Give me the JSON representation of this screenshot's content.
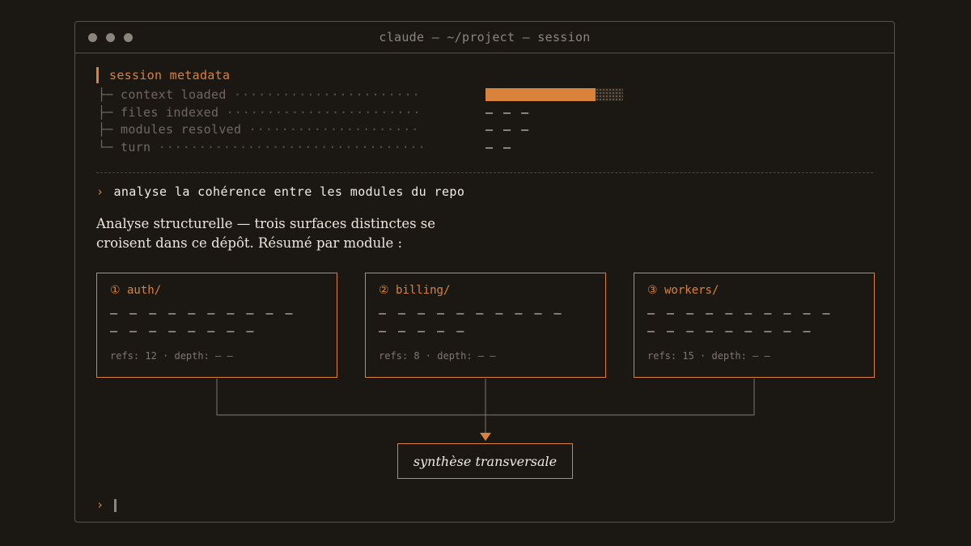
{
  "window": {
    "title": "claude — ~/project — session"
  },
  "metadata": {
    "heading": "session metadata",
    "rows": [
      {
        "branch": "├─",
        "label": "context loaded",
        "leader": "·······················",
        "value": ""
      },
      {
        "branch": "├─",
        "label": "files indexed",
        "leader": "························",
        "value": "— — —"
      },
      {
        "branch": "├─",
        "label": "modules resolved",
        "leader": "·····················",
        "value": "— — —"
      },
      {
        "branch": "└─",
        "label": "turn",
        "leader": "·································",
        "value": "— —"
      }
    ],
    "context_progress": 0.8
  },
  "prompt": {
    "caret": "›",
    "text": "analyse la cohérence entre les modules du repo"
  },
  "answer": {
    "line1": "Analyse structurelle — trois surfaces distinctes se",
    "line2": "croisent dans ce dépôt. Résumé par module :"
  },
  "modules": [
    {
      "title": "① auth/",
      "line1": "— — — — — — — — — —",
      "line2": "— — — — — — — —",
      "footer": "refs: 12 · depth: — —"
    },
    {
      "title": "② billing/",
      "line1": "— — — — — — — — — —",
      "line2": "— — — — —",
      "footer": "refs: 8 · depth: — —"
    },
    {
      "title": "③ workers/",
      "line1": "— — — — — — — — — —",
      "line2": "— — — — — — — — —",
      "footer": "refs: 15 · depth: — —"
    }
  ],
  "synthesis": {
    "label": "synthèse transversale"
  },
  "input": {
    "caret": "›"
  },
  "colors": {
    "accent": "#d9823c",
    "background": "#1b1814",
    "border": "#57524b"
  }
}
